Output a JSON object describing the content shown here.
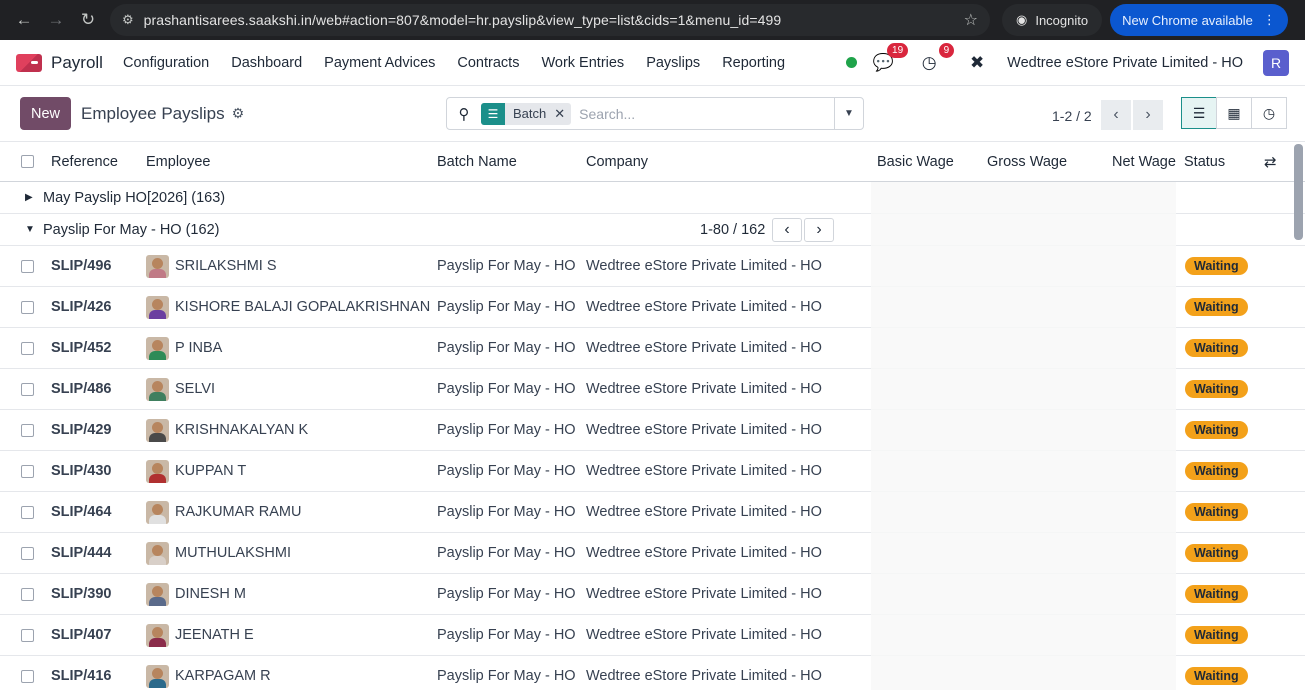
{
  "browser": {
    "url": "prashantisarees.saakshi.in/web#action=807&model=hr.payslip&view_type=list&cids=1&menu_id=499",
    "incognito_label": "Incognito",
    "update_label": "New Chrome available"
  },
  "nav": {
    "app_name": "Payroll",
    "menu": [
      "Configuration",
      "Dashboard",
      "Payment Advices",
      "Contracts",
      "Work Entries",
      "Payslips",
      "Reporting"
    ],
    "messages_count": "19",
    "activities_count": "9",
    "company": "Wedtree eStore Private Limited - HO",
    "user_initial": "R"
  },
  "control": {
    "new_label": "New",
    "title": "Employee Payslips",
    "facet_label": "Batch",
    "search_placeholder": "Search...",
    "pager": "1-2 / 2"
  },
  "columns": {
    "reference": "Reference",
    "employee": "Employee",
    "batch": "Batch Name",
    "company": "Company",
    "basic": "Basic Wage",
    "gross": "Gross Wage",
    "net": "Net Wage",
    "status": "Status"
  },
  "groups": [
    {
      "label": "May Payslip HO[2026] (163)",
      "expanded": false
    },
    {
      "label": "Payslip For May - HO (162)",
      "expanded": true,
      "pager": "1-80 / 162"
    }
  ],
  "rows": [
    {
      "ref": "SLIP/496",
      "employee": "SRILAKSHMI S",
      "batch": "Payslip For May - HO",
      "company": "Wedtree eStore Private Limited - HO",
      "status": "Waiting",
      "color": "#c07a86"
    },
    {
      "ref": "SLIP/426",
      "employee": "KISHORE BALAJI GOPALAKRISHNAN",
      "batch": "Payslip For May - HO",
      "company": "Wedtree eStore Private Limited - HO",
      "status": "Waiting",
      "color": "#6b3fa0"
    },
    {
      "ref": "SLIP/452",
      "employee": "P INBA",
      "batch": "Payslip For May - HO",
      "company": "Wedtree eStore Private Limited - HO",
      "status": "Waiting",
      "color": "#2e8b57"
    },
    {
      "ref": "SLIP/486",
      "employee": "SELVI",
      "batch": "Payslip For May - HO",
      "company": "Wedtree eStore Private Limited - HO",
      "status": "Waiting",
      "color": "#3f7f5f"
    },
    {
      "ref": "SLIP/429",
      "employee": "KRISHNAKALYAN K",
      "batch": "Payslip For May - HO",
      "company": "Wedtree eStore Private Limited - HO",
      "status": "Waiting",
      "color": "#4a4a4a"
    },
    {
      "ref": "SLIP/430",
      "employee": "KUPPAN T",
      "batch": "Payslip For May - HO",
      "company": "Wedtree eStore Private Limited - HO",
      "status": "Waiting",
      "color": "#b03030"
    },
    {
      "ref": "SLIP/464",
      "employee": "RAJKUMAR RAMU",
      "batch": "Payslip For May - HO",
      "company": "Wedtree eStore Private Limited - HO",
      "status": "Waiting",
      "color": "#e0e0e0"
    },
    {
      "ref": "SLIP/444",
      "employee": "MUTHULAKSHMI",
      "batch": "Payslip For May - HO",
      "company": "Wedtree eStore Private Limited - HO",
      "status": "Waiting",
      "color": "#d8cfc8"
    },
    {
      "ref": "SLIP/390",
      "employee": "DINESH M",
      "batch": "Payslip For May - HO",
      "company": "Wedtree eStore Private Limited - HO",
      "status": "Waiting",
      "color": "#5a6a8a"
    },
    {
      "ref": "SLIP/407",
      "employee": "JEENATH E",
      "batch": "Payslip For May - HO",
      "company": "Wedtree eStore Private Limited - HO",
      "status": "Waiting",
      "color": "#8b2c4a"
    },
    {
      "ref": "SLIP/416",
      "employee": "KARPAGAM R",
      "batch": "Payslip For May - HO",
      "company": "Wedtree eStore Private Limited - HO",
      "status": "Waiting",
      "color": "#2c6a8b"
    }
  ]
}
